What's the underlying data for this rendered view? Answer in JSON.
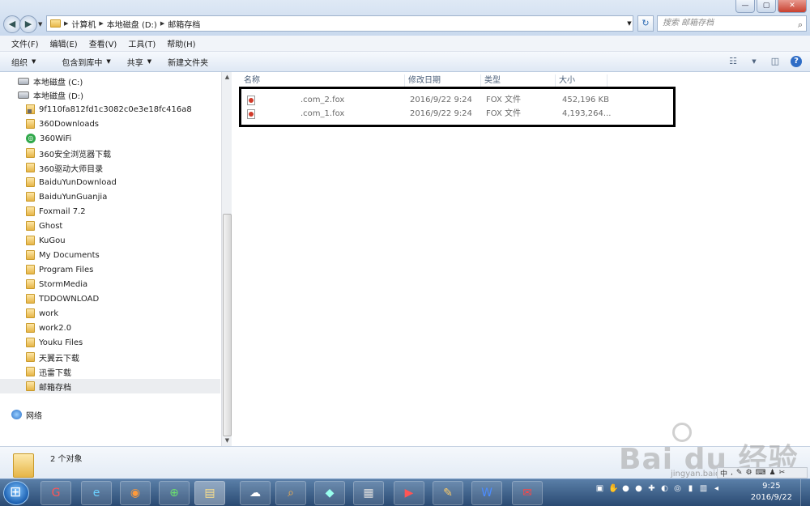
{
  "window": {
    "minimize": "—",
    "maximize": "▢",
    "close": "✕"
  },
  "address": {
    "crumbs": [
      "计算机",
      "本地磁盘 (D:)",
      "邮箱存档"
    ]
  },
  "search": {
    "placeholder": "搜索 邮箱存档"
  },
  "menu": [
    "文件(F)",
    "编辑(E)",
    "查看(V)",
    "工具(T)",
    "帮助(H)"
  ],
  "toolbar": {
    "organize": "组织",
    "include_library": "包含到库中",
    "share": "共享",
    "new_folder": "新建文件夹"
  },
  "nav": {
    "drive_c": "本地磁盘 (C:)",
    "drive_d": "本地磁盘 (D:)",
    "folders": [
      "9f110fa812fd1c3082c0e3e18fc416a8",
      "360Downloads",
      "360WiFi",
      "360安全浏览器下载",
      "360驱动大师目录",
      "BaiduYunDownload",
      "BaiduYunGuanjia",
      "Foxmail 7.2",
      "Ghost",
      "KuGou",
      "My Documents",
      "Program Files",
      "StormMedia",
      "TDDOWNLOAD",
      "work",
      "work2.0",
      "Youku Files",
      "天翼云下载",
      "迅雷下载",
      "邮箱存档"
    ],
    "selected": "邮箱存档",
    "network": "网络"
  },
  "columns": {
    "name": "名称",
    "modified": "修改日期",
    "type": "类型",
    "size": "大小"
  },
  "files": [
    {
      "name": ".com_2.fox",
      "modified": "2016/9/22 9:24",
      "type": "FOX 文件",
      "size": "452,196 KB"
    },
    {
      "name": ".com_1.fox",
      "modified": "2016/9/22 9:24",
      "type": "FOX 文件",
      "size": "4,193,264..."
    }
  ],
  "details": {
    "count": "2 个对象"
  },
  "watermark": {
    "brand": "Bai du 经验",
    "sub": "jingyan.baidu.com"
  },
  "ime": {
    "mode": "中"
  },
  "clock": {
    "time": "9:25",
    "date": "2016/9/22"
  }
}
